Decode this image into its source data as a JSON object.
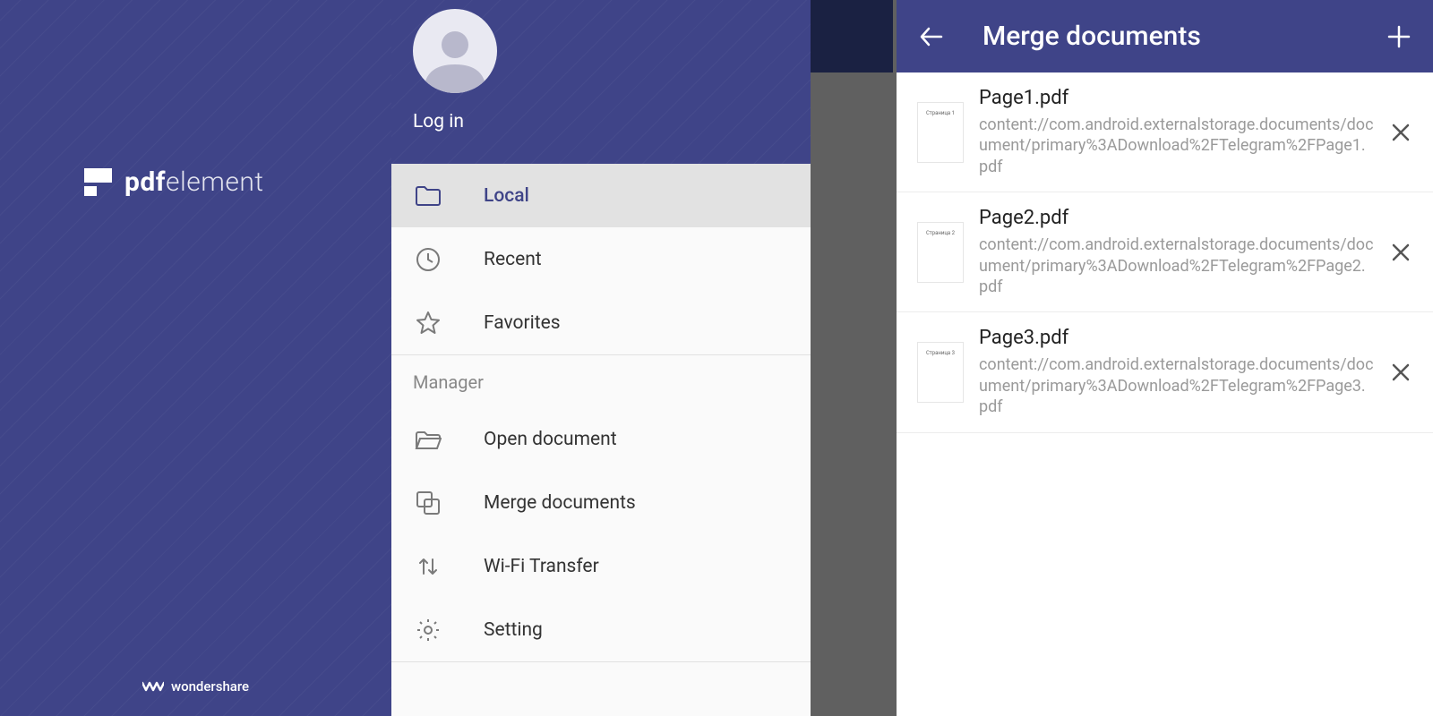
{
  "brand": {
    "name_bold": "pdf",
    "name_light": "element",
    "footer": "wondershare"
  },
  "drawer": {
    "login": "Log in",
    "nav": {
      "local": "Local",
      "recent": "Recent",
      "favorites": "Favorites"
    },
    "manager_header": "Manager",
    "manager": {
      "open": "Open document",
      "merge": "Merge documents",
      "wifi": "Wi-Fi Transfer",
      "setting": "Setting"
    }
  },
  "merge": {
    "title": "Merge documents",
    "items": [
      {
        "thumb": "Страница 1",
        "name": "Page1.pdf",
        "path": "content://com.android.externalstorage.documents/document/primary%3ADownload%2FTelegram%2FPage1.pdf"
      },
      {
        "thumb": "Страница 2",
        "name": "Page2.pdf",
        "path": "content://com.android.externalstorage.documents/document/primary%3ADownload%2FTelegram%2FPage2.pdf"
      },
      {
        "thumb": "Страница 3",
        "name": "Page3.pdf",
        "path": "content://com.android.externalstorage.documents/document/primary%3ADownload%2FTelegram%2FPage3.pdf"
      }
    ]
  }
}
